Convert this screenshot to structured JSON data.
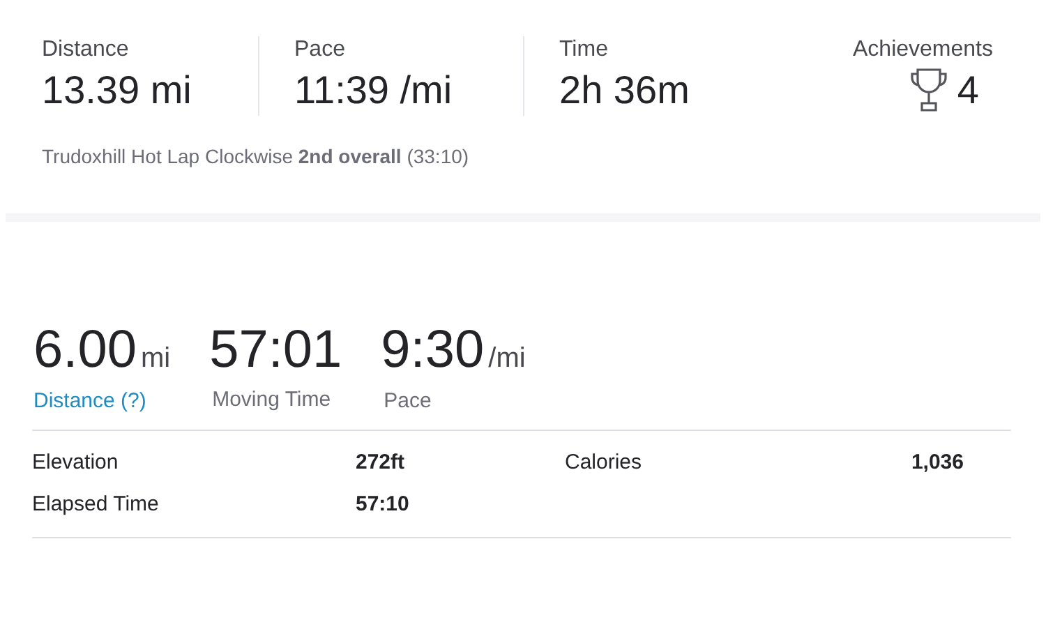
{
  "summary_stats": [
    {
      "label": "Distance",
      "value": "13.39 mi"
    },
    {
      "label": "Pace",
      "value": "11:39 /mi"
    },
    {
      "label": "Time",
      "value": "2h 36m"
    }
  ],
  "achievements": {
    "label": "Achievements",
    "count": "4"
  },
  "segment": "Trudoxhill Hot Lap Clockwise **2nd overall** (33:10)",
  "main_stats": [
    {
      "value": "6.00",
      "unit": "mi",
      "label": "Distance (?)",
      "kind": "link"
    },
    {
      "value": "57:01",
      "label": "Moving Time",
      "kind": "plain"
    },
    {
      "value": "9:30",
      "unit": "/mi",
      "label": "Pace",
      "kind": "plain"
    }
  ],
  "details": [
    {
      "label": "Elevation",
      "value": "272ft"
    },
    {
      "label": "Calories",
      "value": "1,036"
    },
    {
      "label": "Elapsed Time",
      "value": "57:10"
    }
  ]
}
